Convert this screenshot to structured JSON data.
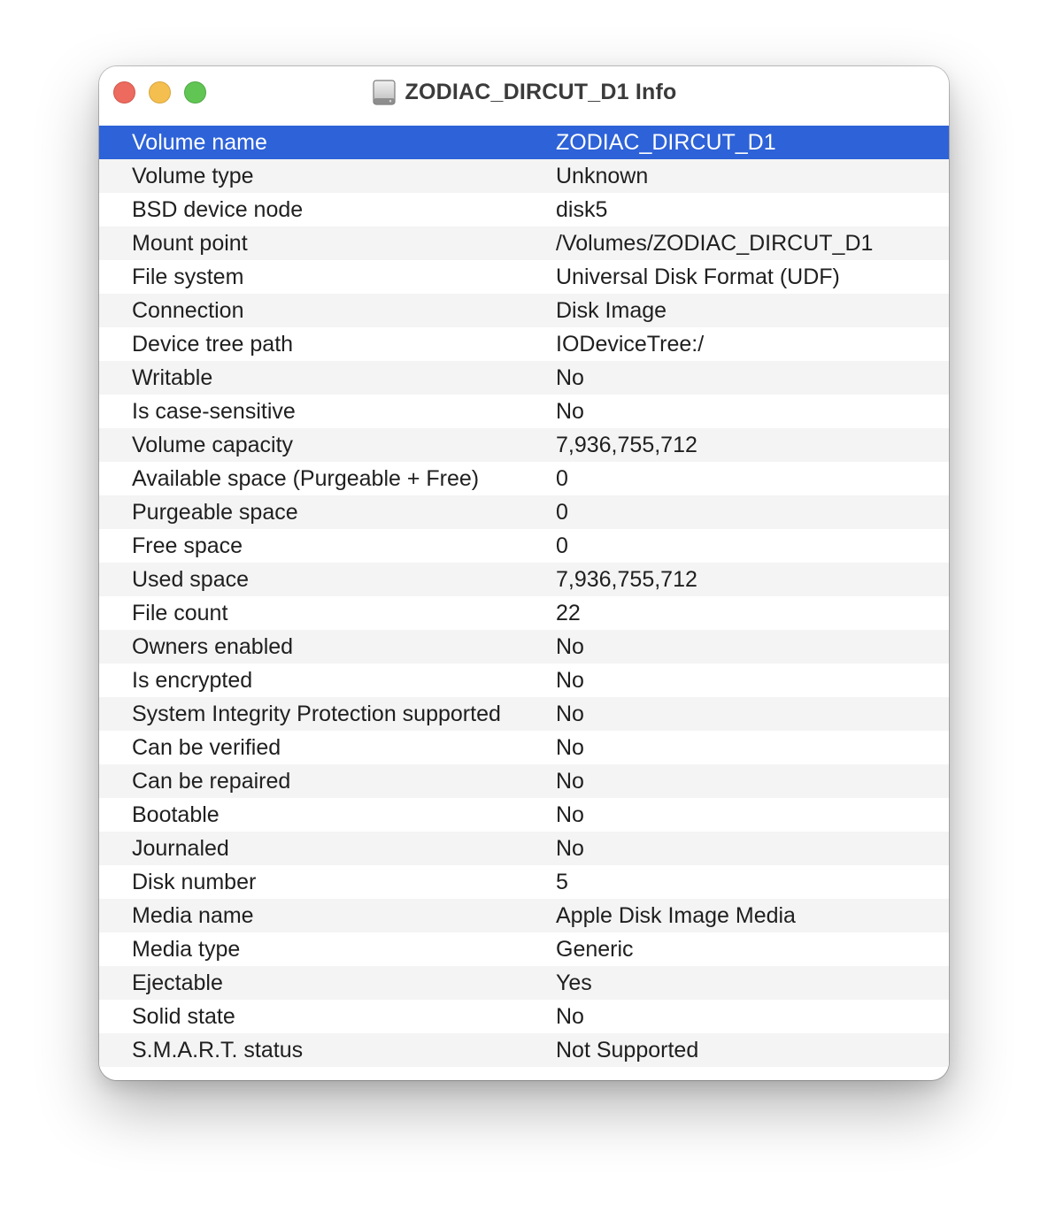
{
  "window": {
    "title": "ZODIAC_DIRCUT_D1 Info",
    "title_icon": "external-drive-icon"
  },
  "colors": {
    "selection": "#2d62d8",
    "close": "#ed6a5e",
    "minimize": "#f5bf4f",
    "zoom": "#61c554",
    "stripe": "#f4f4f4"
  },
  "rows": [
    {
      "key": "Volume name",
      "value": "ZODIAC_DIRCUT_D1",
      "selected": true
    },
    {
      "key": "Volume type",
      "value": "Unknown"
    },
    {
      "key": "BSD device node",
      "value": "disk5"
    },
    {
      "key": "Mount point",
      "value": "/Volumes/ZODIAC_DIRCUT_D1"
    },
    {
      "key": "File system",
      "value": "Universal Disk Format (UDF)"
    },
    {
      "key": "Connection",
      "value": "Disk Image"
    },
    {
      "key": "Device tree path",
      "value": "IODeviceTree:/"
    },
    {
      "key": "Writable",
      "value": "No"
    },
    {
      "key": "Is case-sensitive",
      "value": "No"
    },
    {
      "key": "Volume capacity",
      "value": "7,936,755,712"
    },
    {
      "key": "Available space (Purgeable + Free)",
      "value": "0"
    },
    {
      "key": "Purgeable space",
      "value": "0"
    },
    {
      "key": "Free space",
      "value": "0"
    },
    {
      "key": "Used space",
      "value": "7,936,755,712"
    },
    {
      "key": "File count",
      "value": "22"
    },
    {
      "key": "Owners enabled",
      "value": "No"
    },
    {
      "key": "Is encrypted",
      "value": "No"
    },
    {
      "key": "System Integrity Protection supported",
      "value": "No"
    },
    {
      "key": "Can be verified",
      "value": "No"
    },
    {
      "key": "Can be repaired",
      "value": "No"
    },
    {
      "key": "Bootable",
      "value": "No"
    },
    {
      "key": "Journaled",
      "value": "No"
    },
    {
      "key": "Disk number",
      "value": "5"
    },
    {
      "key": "Media name",
      "value": "Apple Disk Image Media"
    },
    {
      "key": "Media type",
      "value": "Generic"
    },
    {
      "key": "Ejectable",
      "value": "Yes"
    },
    {
      "key": "Solid state",
      "value": "No"
    },
    {
      "key": "S.M.A.R.T. status",
      "value": "Not Supported"
    }
  ]
}
